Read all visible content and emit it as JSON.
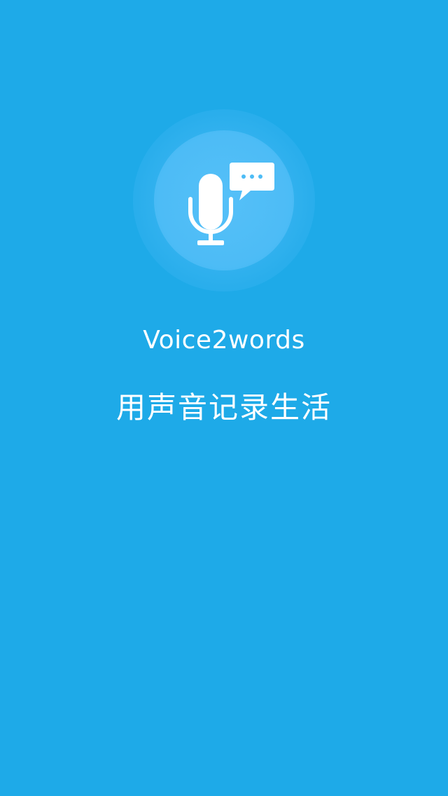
{
  "splash": {
    "app_name": "Voice2words",
    "slogan": "用声音记录生活",
    "logo_icon": "microphone-speech-bubble-icon"
  },
  "colors": {
    "background": "#1eaae8",
    "logo_circle": "#4dbcf6",
    "text": "#ffffff"
  }
}
